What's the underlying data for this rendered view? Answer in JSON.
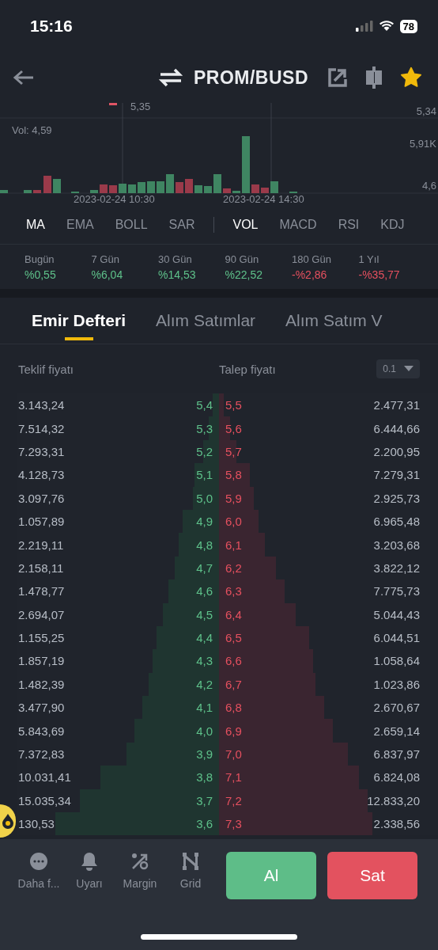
{
  "status_bar": {
    "time": "15:16",
    "battery": "78"
  },
  "header": {
    "title": "PROM/BUSD",
    "favorite": true
  },
  "chart": {
    "price_marker": "5,35",
    "volume_label": "Vol: 4,59",
    "axis_labels": [
      "5,34",
      "5,91K",
      "4,6"
    ],
    "time_labels": [
      "2023-02-24 10:30",
      "2023-02-24 14:30"
    ]
  },
  "indicator_tabs": {
    "main": [
      {
        "label": "MA",
        "selected": true
      },
      {
        "label": "EMA",
        "selected": false
      },
      {
        "label": "BOLL",
        "selected": false
      },
      {
        "label": "SAR",
        "selected": false
      }
    ],
    "sub": [
      {
        "label": "VOL",
        "selected": true
      },
      {
        "label": "MACD",
        "selected": false
      },
      {
        "label": "RSI",
        "selected": false
      },
      {
        "label": "KDJ",
        "selected": false
      }
    ]
  },
  "performance": [
    {
      "period": "Bugün",
      "change": "%0,55",
      "color": "#5ec18a"
    },
    {
      "period": "7 Gün",
      "change": "%6,04",
      "color": "#5ec18a"
    },
    {
      "period": "30 Gün",
      "change": "%14,53",
      "color": "#5ec18a"
    },
    {
      "period": "90 Gün",
      "change": "%22,52",
      "color": "#5ec18a"
    },
    {
      "period": "180 Gün",
      "change": "-%2,86",
      "color": "#e6505f"
    },
    {
      "period": "1 Yıl",
      "change": "-%35,77",
      "color": "#e6505f"
    }
  ],
  "tabs": [
    {
      "label": "Emir Defteri",
      "selected": true
    },
    {
      "label": "Alım Satımlar",
      "selected": false
    },
    {
      "label": "Alım Satım V",
      "selected": false
    }
  ],
  "order_book": {
    "bid_header": "Teklif fiyatı",
    "ask_header": "Talep fiyatı",
    "precision": "0.1",
    "rows": [
      {
        "bid": {
          "qty": "3.143,24",
          "price": "5,4",
          "level": 0.03
        },
        "ask": {
          "price": "5,5",
          "qty": "2.477,31",
          "level": 0.02
        }
      },
      {
        "bid": {
          "qty": "7.514,32",
          "price": "5,3",
          "level": 0.05
        },
        "ask": {
          "price": "5,6",
          "qty": "6.444,66",
          "level": 0.05
        }
      },
      {
        "bid": {
          "qty": "7.293,31",
          "price": "5,2",
          "level": 0.08
        },
        "ask": {
          "price": "5,7",
          "qty": "2.200,95",
          "level": 0.08
        }
      },
      {
        "bid": {
          "qty": "4.128,73",
          "price": "5,1",
          "level": 0.12
        },
        "ask": {
          "price": "5,8",
          "qty": "7.279,31",
          "level": 0.14
        }
      },
      {
        "bid": {
          "qty": "3.097,76",
          "price": "5,0",
          "level": 0.13
        },
        "ask": {
          "price": "5,9",
          "qty": "2.925,73",
          "level": 0.16
        }
      },
      {
        "bid": {
          "qty": "1.057,89",
          "price": "4,9",
          "level": 0.18
        },
        "ask": {
          "price": "6,0",
          "qty": "6.965,48",
          "level": 0.18
        }
      },
      {
        "bid": {
          "qty": "2.219,11",
          "price": "4,8",
          "level": 0.2
        },
        "ask": {
          "price": "6,1",
          "qty": "3.203,68",
          "level": 0.21
        }
      },
      {
        "bid": {
          "qty": "2.158,11",
          "price": "4,7",
          "level": 0.22
        },
        "ask": {
          "price": "6,2",
          "qty": "3.822,12",
          "level": 0.26
        }
      },
      {
        "bid": {
          "qty": "1.478,77",
          "price": "4,6",
          "level": 0.25
        },
        "ask": {
          "price": "6,3",
          "qty": "7.775,73",
          "level": 0.3
        }
      },
      {
        "bid": {
          "qty": "2.694,07",
          "price": "4,5",
          "level": 0.28
        },
        "ask": {
          "price": "6,4",
          "qty": "5.044,43",
          "level": 0.35
        }
      },
      {
        "bid": {
          "qty": "1.155,25",
          "price": "4,4",
          "level": 0.31
        },
        "ask": {
          "price": "6,5",
          "qty": "6.044,51",
          "level": 0.41
        }
      },
      {
        "bid": {
          "qty": "1.857,19",
          "price": "4,3",
          "level": 0.33
        },
        "ask": {
          "price": "6,6",
          "qty": "1.058,64",
          "level": 0.43
        }
      },
      {
        "bid": {
          "qty": "1.482,39",
          "price": "4,2",
          "level": 0.35
        },
        "ask": {
          "price": "6,7",
          "qty": "1.023,86",
          "level": 0.44
        }
      },
      {
        "bid": {
          "qty": "3.477,90",
          "price": "4,1",
          "level": 0.38
        },
        "ask": {
          "price": "6,8",
          "qty": "2.670,67",
          "level": 0.48
        }
      },
      {
        "bid": {
          "qty": "5.843,69",
          "price": "4,0",
          "level": 0.42
        },
        "ask": {
          "price": "6,9",
          "qty": "2.659,14",
          "level": 0.52
        }
      },
      {
        "bid": {
          "qty": "7.372,83",
          "price": "3,9",
          "level": 0.46
        },
        "ask": {
          "price": "7,0",
          "qty": "6.837,97",
          "level": 0.59
        }
      },
      {
        "bid": {
          "qty": "10.031,41",
          "price": "3,8",
          "level": 0.59
        },
        "ask": {
          "price": "7,1",
          "qty": "6.824,08",
          "level": 0.64
        }
      },
      {
        "bid": {
          "qty": "15.035,34",
          "price": "3,7",
          "level": 0.69
        },
        "ask": {
          "price": "7,2",
          "qty": "12.833,20",
          "level": 0.68
        }
      },
      {
        "bid": {
          "qty": "130,53",
          "price": "3,6",
          "level": 0.81
        },
        "ask": {
          "price": "7,3",
          "qty": "2.338,56",
          "level": 0.7
        }
      }
    ]
  },
  "bottom_nav": [
    {
      "label": "Daha f..."
    },
    {
      "label": "Uyarı"
    },
    {
      "label": "Margin"
    },
    {
      "label": "Grid"
    }
  ],
  "actions": {
    "buy": "Al",
    "sell": "Sat"
  }
}
